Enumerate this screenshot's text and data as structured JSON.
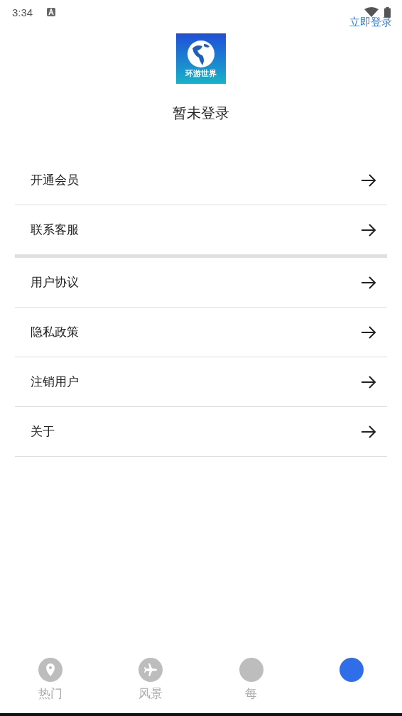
{
  "status_bar": {
    "time": "3:34"
  },
  "login_link": "立即登录",
  "logo": {
    "text": "环游世界"
  },
  "user": {
    "name": "暂未登录"
  },
  "menu_groups": [
    [
      {
        "label": "开通会员"
      },
      {
        "label": "联系客服"
      }
    ],
    [
      {
        "label": "用户协议"
      },
      {
        "label": "隐私政策"
      },
      {
        "label": "注销用户"
      },
      {
        "label": "关于"
      }
    ]
  ],
  "tabs": [
    {
      "kind": "pin",
      "label": "热门",
      "selected": false
    },
    {
      "kind": "plane",
      "label": "风景",
      "selected": false
    },
    {
      "kind": "plain",
      "label": "每",
      "selected": false
    },
    {
      "kind": "plain",
      "selected": true
    }
  ]
}
